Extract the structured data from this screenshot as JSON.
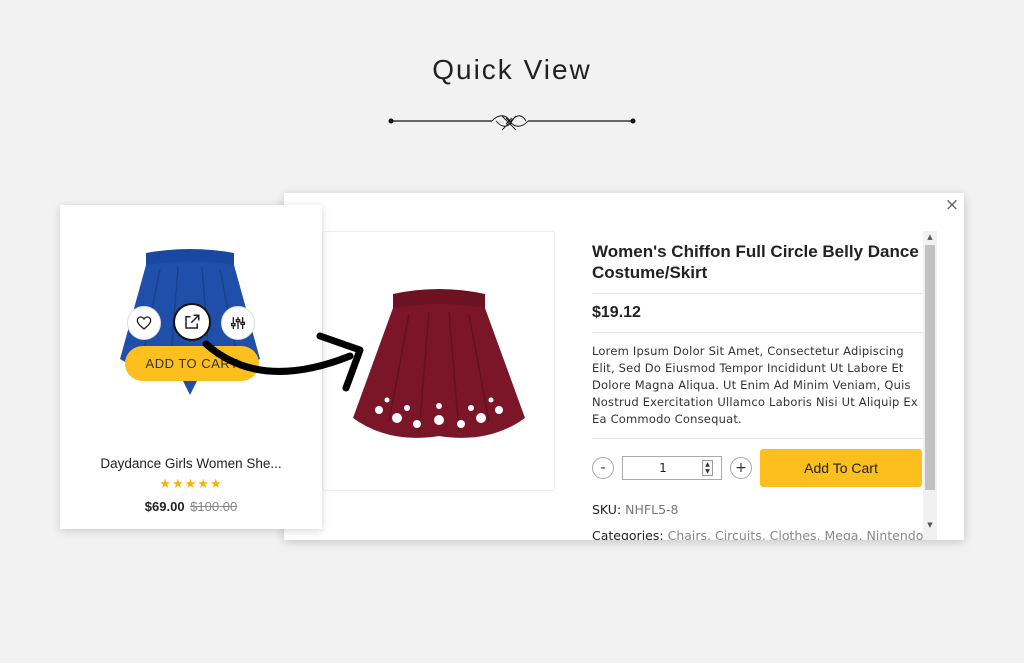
{
  "heading": "Quick View",
  "card": {
    "name": "Daydance Girls Women She...",
    "rating_stars": "★★★★★",
    "rating": 5,
    "price": "$69.00",
    "old_price": "$100.00",
    "add_to_cart_label": "ADD TO CART",
    "image_color": "#1f4fa8",
    "icons": [
      "heart-icon",
      "quick-view-icon",
      "compare-icon"
    ]
  },
  "modal": {
    "close": "×",
    "title": "Women's Chiffon Full Circle Belly Dance Costume/Skirt",
    "price": "$19.12",
    "description": "Lorem Ipsum Dolor Sit Amet, Consectetur Adipiscing Elit, Sed Do Eiusmod Tempor Incididunt Ut Labore Et Dolore Magna Aliqua. Ut Enim Ad Minim Veniam, Quis Nostrud Exercitation Ullamco Laboris Nisi Ut Aliquip Ex Ea Commodo Consequat.",
    "quantity": {
      "minus": "-",
      "value": "1",
      "plus": "+"
    },
    "add_to_cart_label": "Add To Cart",
    "sku_label": "SKU:",
    "sku_value": "NHFL5-8",
    "categories_label": "Categories:",
    "categories_value": "Chairs, Circuits, Clothes, Mega, Nintendo",
    "image_color": "#7a1628"
  },
  "colors": {
    "accent": "#fcbf1e",
    "star": "#f7b500",
    "background": "#f2f2f2"
  }
}
